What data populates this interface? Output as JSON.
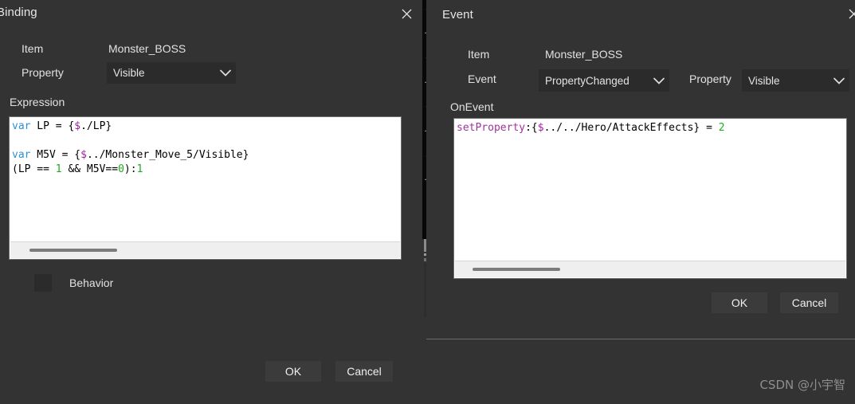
{
  "binding_dialog": {
    "title": "Binding",
    "close_icon": "close-icon",
    "item_label": "Item",
    "item_value": "Monster_BOSS",
    "property_label": "Property",
    "property_value": "Visible",
    "property_options": [
      "Visible"
    ],
    "expression_label": "Expression",
    "expression_code_lines": [
      "var LP = {$./LP}",
      "",
      "var M5V = {$../Monster_Move_5/Visible}",
      "(LP == 1 && M5V==0):1"
    ],
    "expression_code_text": "var LP = {$./LP}\n\nvar M5V = {$../Monster_Move_5/Visible}\n(LP == 1 && M5V==0):1",
    "behavior_label": "Behavior",
    "behavior_checked": false,
    "ok_label": "OK",
    "cancel_label": "Cancel"
  },
  "event_dialog": {
    "title": "Event",
    "close_icon": "close-icon",
    "item_label": "Item",
    "item_value": "Monster_BOSS",
    "event_label": "Event",
    "event_value": "PropertyChanged",
    "event_options": [
      "PropertyChanged"
    ],
    "property_label": "Property",
    "property_value": "Visible",
    "property_options": [
      "Visible"
    ],
    "onevent_label": "OnEvent",
    "onevent_code_lines": [
      "setProperty:{$../../Hero/AttackEffects} = 2"
    ],
    "onevent_code_text": "setProperty:{$../../Hero/AttackEffects} = 2",
    "ok_label": "OK",
    "cancel_label": "Cancel"
  },
  "background": {
    "tree_strip_marks": [
      "-",
      "+",
      "-",
      "+",
      "-",
      "+",
      "-",
      "+"
    ],
    "scrollbar_name": "vertical-scrollbar"
  },
  "watermark": {
    "text": "CSDN @小宇智"
  },
  "colors": {
    "window_bg": "#333333",
    "input_bg": "#2b2b2b",
    "button_bg": "#3b3b3b",
    "editor_bg": "#ffffff",
    "text": "#e2e2e2",
    "keyword": "#2b91d4",
    "variable": "#a020a0",
    "number": "#1faa1f",
    "function": "#a0339a"
  }
}
